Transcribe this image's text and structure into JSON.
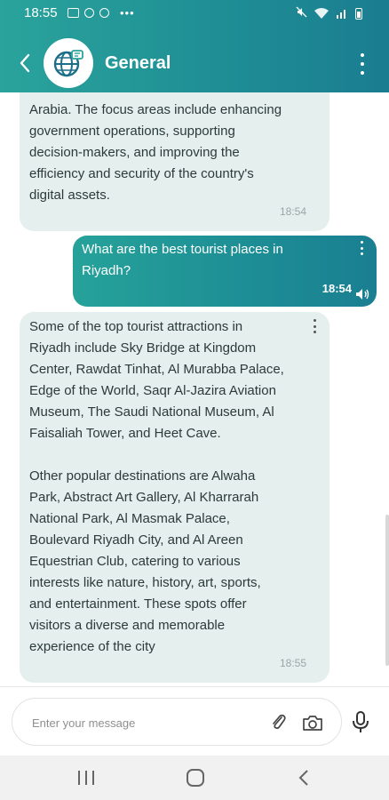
{
  "status_bar": {
    "time": "18:55"
  },
  "header": {
    "title": "General"
  },
  "messages": [
    {
      "direction": "incoming",
      "partial_top": "i Arabia",
      "text": "Arabia. The focus areas include enhancing\ngovernment operations, supporting\ndecision-makers, and improving the\nefficiency and security of the country's\ndigital assets.",
      "time": "18:54"
    },
    {
      "direction": "outgoing",
      "text": "What are the best tourist places in\nRiyadh?",
      "time": "18:54"
    },
    {
      "direction": "incoming",
      "text": "Some of the top tourist attractions in\nRiyadh include Sky Bridge at Kingdom\nCenter, Rawdat Tinhat, Al Murabba Palace,\nEdge of the World, Saqr Al-Jazira Aviation\nMuseum, The Saudi National Museum, Al\nFaisaliah Tower, and Heet Cave.\n\nOther popular destinations are Alwaha\nPark, Abstract Art Gallery, Al Kharrarah\nNational Park, Al Masmak Palace,\nBoulevard Riyadh City, and Al Areen\nEquestrian Club, catering to various\ninterests like nature, history, art, sports,\nand entertainment. These spots offer\nvisitors a diverse and memorable\nexperience of the city",
      "time": "18:55"
    }
  ],
  "composer": {
    "placeholder": "Enter your message"
  },
  "colors": {
    "accent": "#1f8f95",
    "incoming_bubble": "#e4efee",
    "accent_light": "#2aa39c"
  }
}
